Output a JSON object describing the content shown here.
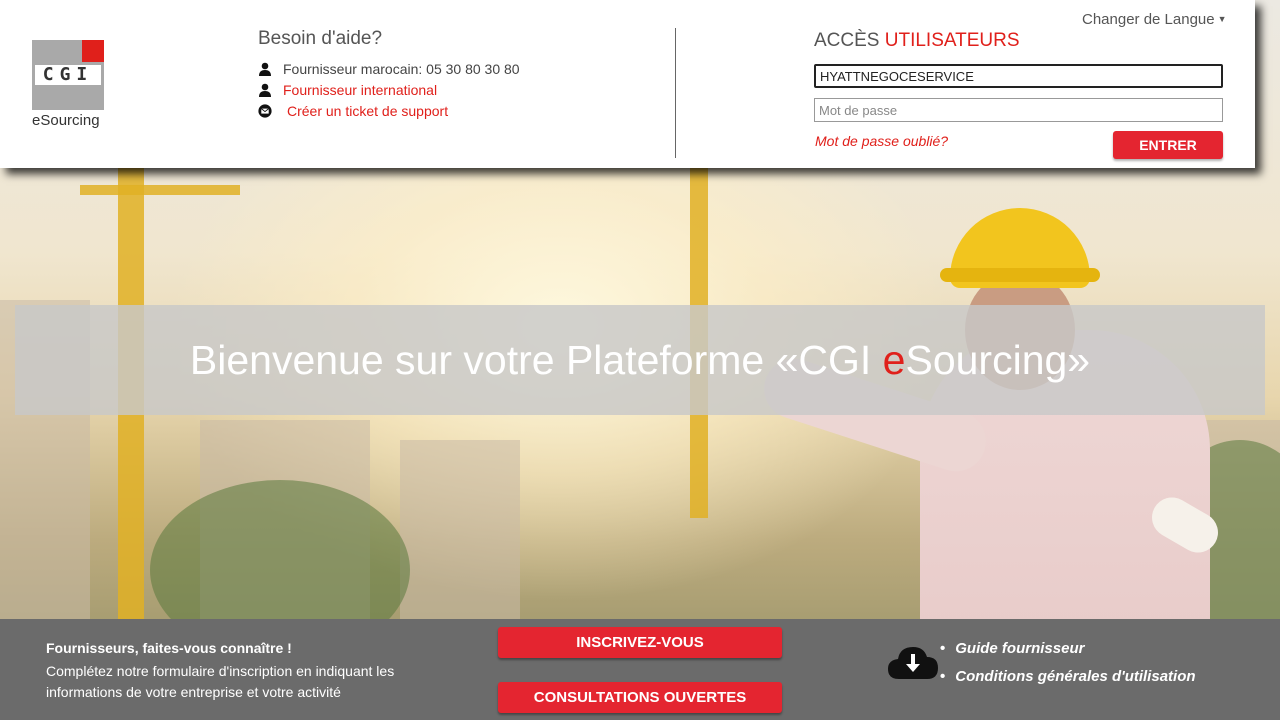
{
  "logo": {
    "letters": "CGI",
    "subtitle": "eSourcing"
  },
  "help": {
    "title": "Besoin d'aide?",
    "items": [
      {
        "icon": "user-icon",
        "label": "Fournisseur marocain: 05 30 80 30 80"
      },
      {
        "icon": "user-icon",
        "label": "Fournisseur international"
      },
      {
        "icon": "mail-icon",
        "label": "Créer un ticket de support"
      }
    ]
  },
  "language": {
    "label": "Changer de Langue"
  },
  "access": {
    "title_prefix": "ACCÈS",
    "title_highlight": "UTILISATEURS",
    "username_value": "HYATTNEGOCESERVICE",
    "password_placeholder": "Mot de passe",
    "forgot_label": "Mot de passe oublié?",
    "submit_label": "ENTRER"
  },
  "banner": {
    "before": "Bienvenue sur votre Plateforme «CGI ",
    "highlight": "e",
    "after": "Sourcing»"
  },
  "footer": {
    "title": "Fournisseurs, faites-vous connaître !",
    "description": "Complétez notre formulaire d'inscription en indiquant les informations de votre entreprise et votre activité",
    "register_label": "INSCRIVEZ-VOUS",
    "consultations_label": "CONSULTATIONS OUVERTES",
    "links": [
      "Guide fournisseur",
      "Conditions générales d'utilisation"
    ]
  },
  "colors": {
    "accent": "#e0201b",
    "button": "#e42530",
    "footer_bg": "#6b6b6b"
  }
}
